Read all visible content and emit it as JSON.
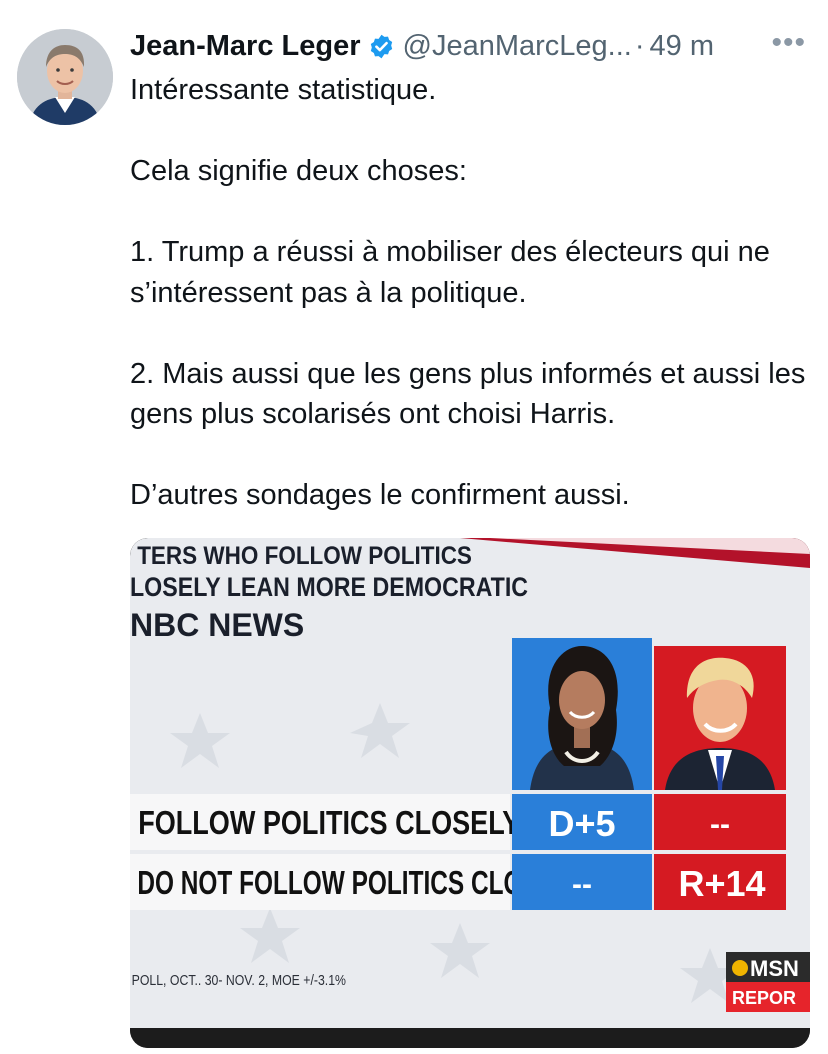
{
  "author": {
    "name": "Jean-Marc Leger",
    "handle": "@JeanMarcLeg...",
    "separator": "·",
    "time": "49 m",
    "verified": true
  },
  "icons": {
    "verified": "verified-badge-icon",
    "more": "more-options-icon"
  },
  "tweet": {
    "paragraphs": [
      "Intéressante statistique.",
      "Cela signifie deux choses:",
      "1. Trump a réussi à mobiliser des électeurs qui ne s’intéressent pas à la politique.",
      "2. Mais aussi que les gens plus informés et aussi les gens plus scolarisés ont choisi Harris.",
      "D’autres sondages le confirment aussi."
    ]
  },
  "media": {
    "headline_line1": "TERS WHO FOLLOW POLITICS",
    "headline_line2": "LOSELY LEAN MORE DEMOCRATIC",
    "network": "NBC NEWS",
    "rows": [
      {
        "label": "FOLLOW POLITICS CLOSELY",
        "democrat": "D+5",
        "republican": "--"
      },
      {
        "label": "DO NOT FOLLOW POLITICS CLOSELY",
        "democrat": "--",
        "republican": "R+14"
      }
    ],
    "footer": "POLL, OCT.. 30- NOV. 2, MOE +/-3.1%",
    "corner_logo_line1": "MSN",
    "corner_logo_line2": "REPOR",
    "colors": {
      "democrat": "#1f7ad6",
      "republican": "#d5141f",
      "background": "#e9ebef"
    }
  },
  "colors": {
    "text": "#0f1419",
    "secondary": "#536471",
    "verified": "#1d9bf0"
  }
}
